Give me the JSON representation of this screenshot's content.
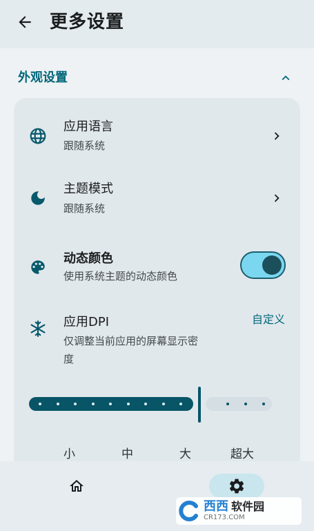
{
  "header": {
    "title": "更多设置",
    "back_icon": "arrow-back-icon"
  },
  "section": {
    "title": "外观设置",
    "collapse_icon": "chevron-up-icon"
  },
  "settings": [
    {
      "icon": "globe-icon",
      "title": "应用语言",
      "subtitle": "跟随系统",
      "action": "chevron-right"
    },
    {
      "icon": "moon-icon",
      "title": "主题模式",
      "subtitle": "跟随系统",
      "action": "chevron-right"
    },
    {
      "icon": "palette-icon",
      "title": "动态颜色",
      "subtitle": "使用系统主题的动态颜色",
      "action": "toggle",
      "enabled": true
    },
    {
      "icon": "snowflake-icon",
      "title": "应用DPI",
      "subtitle_line1": "仅调整当前应用的屏幕显示密",
      "subtitle_line2": "度",
      "action_label": "自定义"
    }
  ],
  "dpi_slider": {
    "labels": [
      "小",
      "中",
      "大",
      "超大"
    ],
    "value_fraction": 0.7
  },
  "bottom_nav": [
    {
      "icon": "home-icon",
      "active": false
    },
    {
      "icon": "gear-icon",
      "active": true
    }
  ],
  "watermark": {
    "brand": "西西",
    "text": "软件园",
    "url": "CR173.COM"
  },
  "colors": {
    "accent": "#00677a",
    "slider_active": "#075567",
    "toggle_track": "#7ad7ef",
    "card_bg": "#e1e8ec"
  }
}
